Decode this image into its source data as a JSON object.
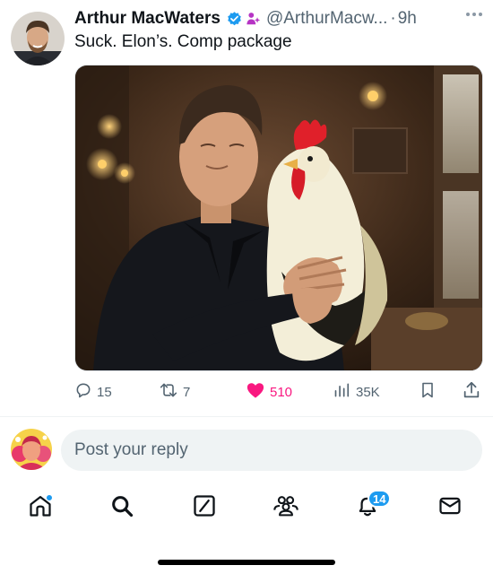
{
  "tweet": {
    "author_name": "Arthur MacWaters",
    "handle": "@ArthurMacw...",
    "separator": "·",
    "time": "9h",
    "text": "Suck. Elon’s. Comp package",
    "avatar_icon": "profile-photo",
    "verified_icon": "verified-badge-icon",
    "affiliate_icon": "affiliation-badge-icon",
    "media": {
      "icon": "photo-man-holding-rooster"
    }
  },
  "actions": {
    "reply": {
      "icon": "reply-icon",
      "count": "15"
    },
    "retweet": {
      "icon": "retweet-icon",
      "count": "7"
    },
    "like": {
      "icon": "heart-filled-icon",
      "count": "510",
      "color": "#f91880"
    },
    "views": {
      "icon": "views-chart-icon",
      "count": "35K"
    },
    "bookmark": {
      "icon": "bookmark-icon"
    },
    "share": {
      "icon": "share-icon"
    }
  },
  "reply_bar": {
    "placeholder": "Post your reply",
    "avatar_icon": "user-avatar"
  },
  "nav": {
    "items": [
      {
        "icon": "home-icon",
        "has_dot": true
      },
      {
        "icon": "search-icon"
      },
      {
        "icon": "grok-icon"
      },
      {
        "icon": "communities-icon"
      },
      {
        "icon": "notifications-icon",
        "badge": "14"
      },
      {
        "icon": "messages-icon"
      }
    ]
  },
  "colors": {
    "accent": "#1d9bf0",
    "like": "#f91880",
    "secondary_text": "#536471",
    "reply_field_bg": "#eff3f4"
  }
}
